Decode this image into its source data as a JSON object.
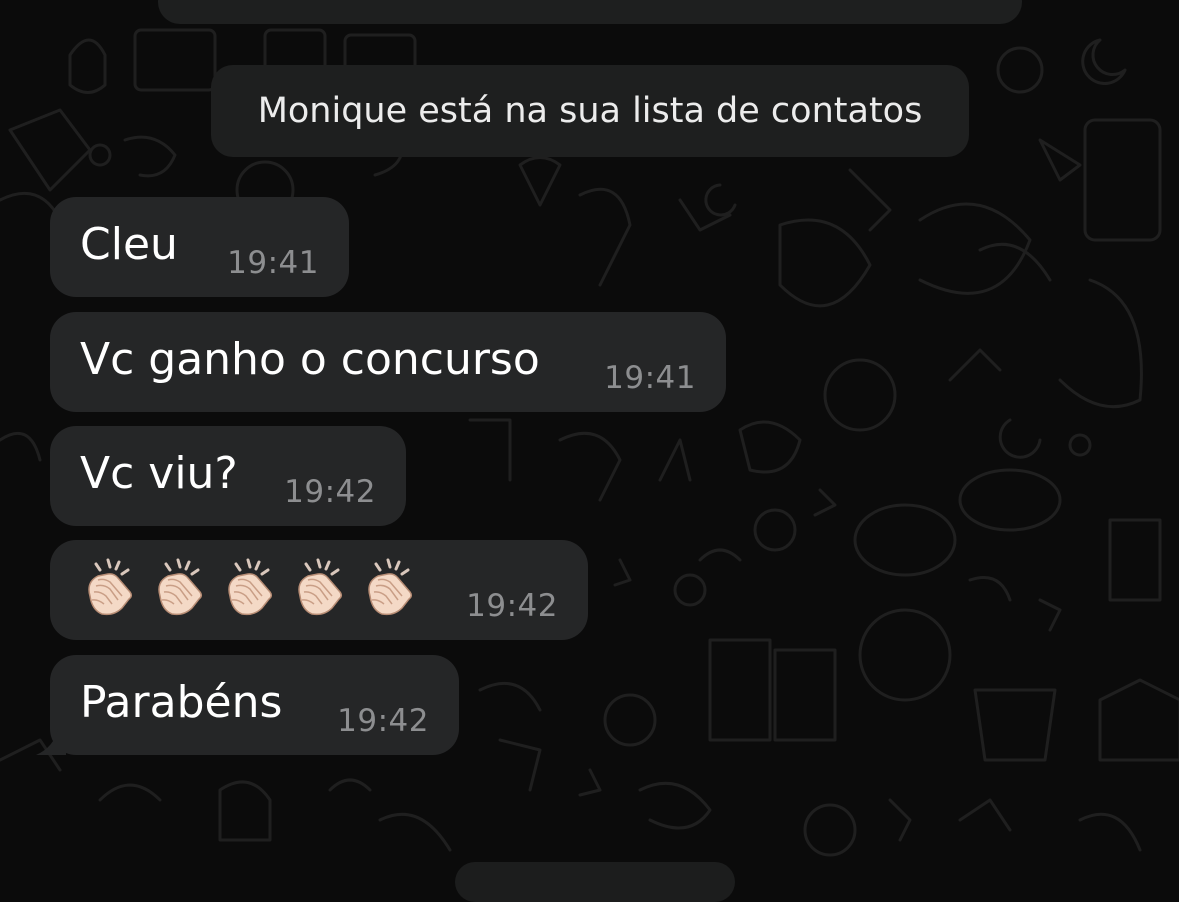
{
  "notice": {
    "text": "Monique está na sua lista de contatos"
  },
  "messages": [
    {
      "text": "Cleu",
      "time": "19:41"
    },
    {
      "text": "Vc ganho o concurso",
      "time": "19:41"
    },
    {
      "text": "Vc viu?",
      "time": "19:42"
    },
    {
      "text": "👏🏻👏🏻👏🏻👏🏻👏🏻",
      "emoji": "clapping-hands-icon",
      "count": 5,
      "time": "19:42"
    },
    {
      "text": "Parabéns",
      "time": "19:42"
    }
  ],
  "colors": {
    "background": "#0b0b0b",
    "bubble": "#252627",
    "notice_bg": "#1e1f1f",
    "message_text": "#ffffff",
    "time_text": "#8d8e90"
  }
}
